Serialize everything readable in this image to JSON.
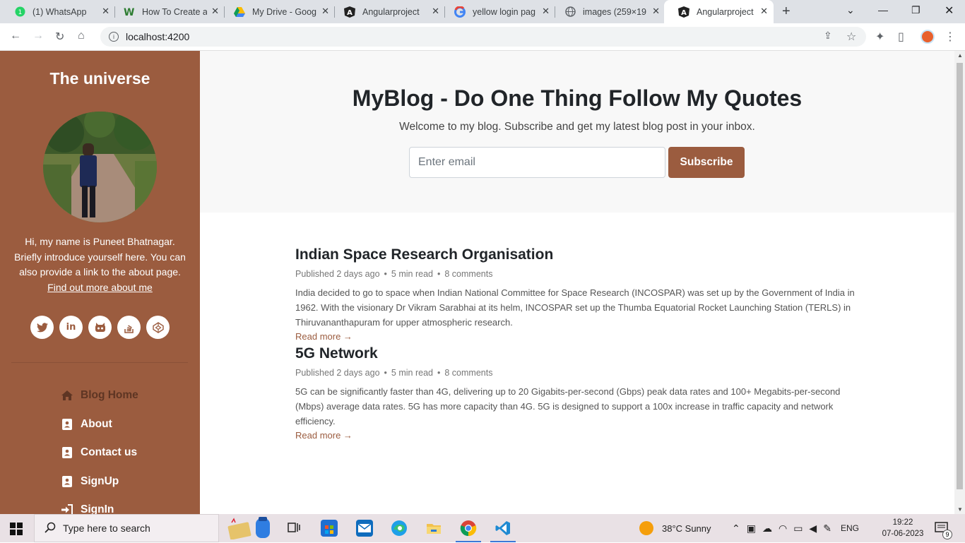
{
  "browser": {
    "tabs": [
      {
        "title": "(1) WhatsApp",
        "icon": "whatsapp-icon"
      },
      {
        "title": "How To Create a",
        "icon": "w-logo-icon"
      },
      {
        "title": "My Drive - Goog",
        "icon": "google-drive-icon"
      },
      {
        "title": "Angularproject",
        "icon": "angular-icon"
      },
      {
        "title": "yellow login pag",
        "icon": "google-icon"
      },
      {
        "title": "images (259×19",
        "icon": "globe-icon"
      },
      {
        "title": "Angularproject",
        "icon": "angular-icon",
        "active": true
      }
    ],
    "url": "localhost:4200"
  },
  "sidebar": {
    "title": "The universe",
    "intro": "Hi, my name is Puneet Bhatnagar. Briefly introduce yourself here. You can also provide a link to the about page.",
    "about_link": "Find out more about me",
    "socials": [
      "twitter-icon",
      "linkedin-icon",
      "github-icon",
      "stackoverflow-icon",
      "codepen-icon"
    ],
    "nav": [
      {
        "label": "Blog Home",
        "icon": "home-icon"
      },
      {
        "label": "About",
        "icon": "contact-card-icon"
      },
      {
        "label": "Contact us",
        "icon": "contact-card-icon"
      },
      {
        "label": "SignUp",
        "icon": "contact-card-icon"
      },
      {
        "label": "SignIn",
        "icon": "sign-in-icon"
      }
    ],
    "colors": {
      "background": "#9b5c3f",
      "active_nav": "#5e3523"
    }
  },
  "hero": {
    "title": "MyBlog - Do One Thing Follow My Quotes",
    "subtitle": "Welcome to my blog. Subscribe and get my latest blog post in your inbox.",
    "email_placeholder": "Enter email",
    "subscribe_label": "Subscribe"
  },
  "posts": [
    {
      "title": "Indian Space Research Organisation",
      "published": "Published 2 days ago",
      "read_time": "5 min read",
      "comments": "8 comments",
      "excerpt": "India decided to go to space when Indian National Committee for Space Research (INCOSPAR) was set up by the Government of India in 1962. With the visionary Dr Vikram Sarabhai at its helm, INCOSPAR set up the Thumba Equatorial Rocket Launching Station (TERLS) in Thiruvananthapuram for upper atmospheric research.",
      "more": "Read more →"
    },
    {
      "title": "5G Network",
      "published": "Published 2 days ago",
      "read_time": "5 min read",
      "comments": "8 comments",
      "excerpt": "5G can be significantly faster than 4G, delivering up to 20 Gigabits-per-second (Gbps) peak data rates and 100+ Megabits-per-second (Mbps) average data rates. 5G has more capacity than 4G. 5G is designed to support a 100x increase in traffic capacity and network efficiency.",
      "more": "Read more →"
    }
  ],
  "taskbar": {
    "search_placeholder": "Type here to search",
    "weather": "38°C  Sunny",
    "language": "ENG",
    "time": "19:22",
    "date": "07-06-2023",
    "notification_count": "9"
  }
}
